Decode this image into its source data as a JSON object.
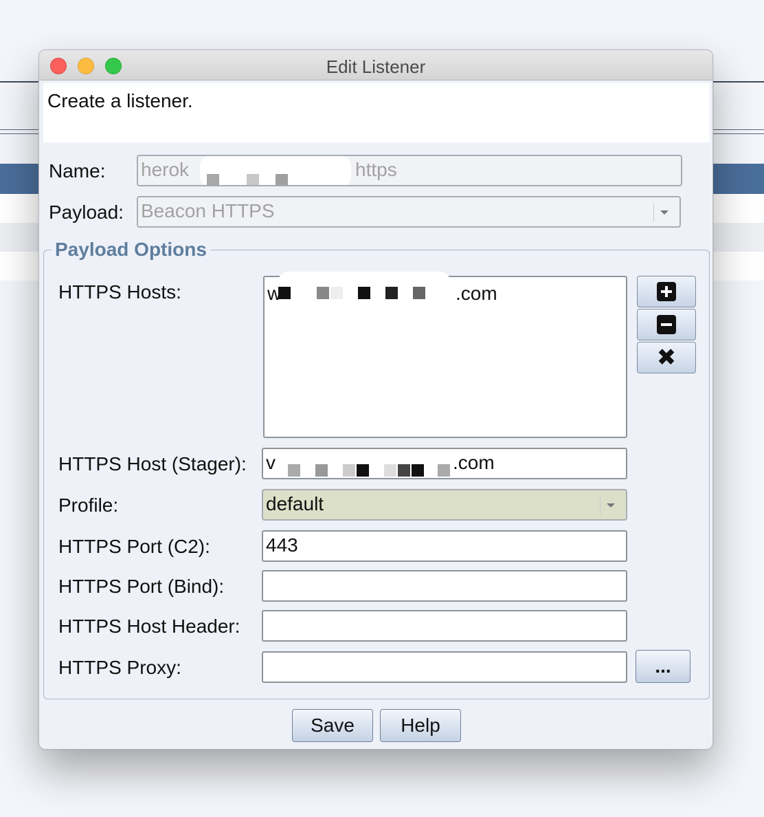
{
  "window": {
    "title": "Edit Listener"
  },
  "description": "Create a listener.",
  "name": {
    "label": "Name:",
    "value_left": "herok",
    "value_right": "https"
  },
  "payload": {
    "label": "Payload:",
    "value": "Beacon HTTPS"
  },
  "group": {
    "title": "Payload Options"
  },
  "https_hosts": {
    "label": "HTTPS Hosts:",
    "items": [
      {
        "prefix": "w",
        "suffix": ".com"
      }
    ]
  },
  "host_stager": {
    "label": "HTTPS Host (Stager):",
    "prefix": "v",
    "suffix": ".com"
  },
  "profile": {
    "label": "Profile:",
    "value": "default"
  },
  "port_c2": {
    "label": "HTTPS Port (C2):",
    "value": "443"
  },
  "port_bind": {
    "label": "HTTPS Port (Bind):",
    "value": ""
  },
  "host_header": {
    "label": "HTTPS Host Header:",
    "value": ""
  },
  "proxy": {
    "label": "HTTPS Proxy:",
    "value": "",
    "button_label": "..."
  },
  "buttons": {
    "save": "Save",
    "help": "Help"
  },
  "icons": {
    "add": "plus-icon",
    "remove": "minus-icon",
    "clear": "close-icon"
  },
  "colors": {
    "profile_bg": "#dde0c9",
    "group_title": "#5f7e9e",
    "button_gradient_bottom": "#c5d2e5"
  }
}
